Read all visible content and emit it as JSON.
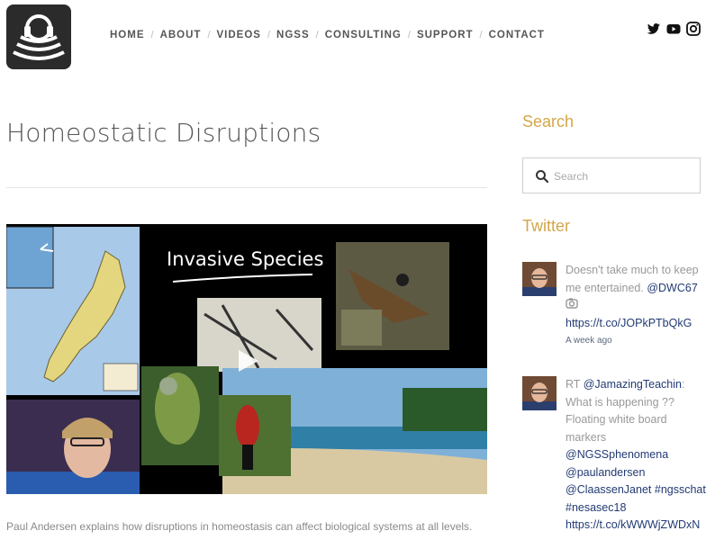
{
  "nav": {
    "items": [
      "HOME",
      "ABOUT",
      "VIDEOS",
      "NGSS",
      "CONSULTING",
      "SUPPORT",
      "CONTACT"
    ]
  },
  "social": [
    "twitter-icon",
    "youtube-icon",
    "instagram-icon"
  ],
  "page": {
    "title": "Homeostatic Disruptions",
    "video_title": "Invasive Species",
    "caption": "Paul Andersen explains how disruptions in homeostasis can affect biological systems at all levels."
  },
  "sidebar": {
    "search_heading": "Search",
    "search_placeholder": "Search",
    "twitter_heading": "Twitter",
    "tweets": [
      {
        "lines": [
          "Doesn't take much to keep",
          "me entertained. ",
          "@DWC67",
          "https://t.co/JOPkPTbQkG"
        ],
        "time": "A week ago"
      },
      {
        "lines": [
          "RT ",
          "@JamazingTeachin",
          ":",
          "What is happening ??",
          "Floating white board",
          "markers",
          "@NGSSphenomena",
          "@paulandersen",
          "@ClaassenJanet",
          " #ngsschat",
          "#nesasec18",
          "https://t.co/kWWWjZWDxN"
        ]
      }
    ]
  },
  "colors": {
    "accent": "#d4a649",
    "link": "#223a73",
    "nav": "#555555"
  }
}
